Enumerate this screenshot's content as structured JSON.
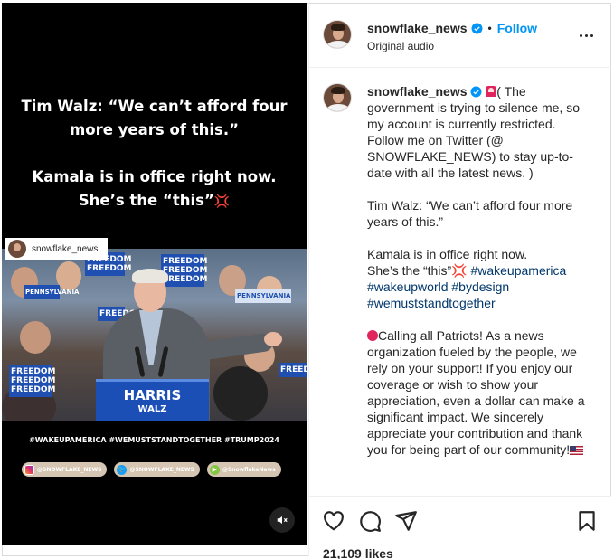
{
  "media": {
    "overlay_line1": "Tim Walz: “We can’t afford four",
    "overlay_line2": "more years of this.”",
    "overlay_line3": "Kamala is in office right now.",
    "overlay_line4": "She’s the “this”",
    "repost_tag": "snowflake_news",
    "sign_text": "FREEDOM",
    "state_sign": "PENNSYLVANIA",
    "podium_title": "HARRIS",
    "podium_subtitle": "WALZ",
    "hashtags": "#WAKEUPAMERICA #WEMUSTSTANDTOGETHER #TRUMP2024",
    "socials": [
      {
        "icon": "instagram-icon",
        "label": "@SNOWFLAKE_NEWS"
      },
      {
        "icon": "twitter-icon",
        "label": "@SNOWFLAKE_NEWS"
      },
      {
        "icon": "rumble-icon",
        "label": "@SnowflakeNews"
      }
    ]
  },
  "header": {
    "username": "snowflake_news",
    "separator": "•",
    "follow_label": "Follow",
    "audio": "Original audio"
  },
  "caption": {
    "username": "snowflake_news",
    "p1_a": "( The government is trying to silence me, so my account is currently restricted. Follow me on Twitter (@ SNOWFLAKE_NEWS) to stay up-to-date with all the latest news. )",
    "p2": "Tim Walz: “We can’t afford four more years of this.”",
    "p3_a": "Kamala is in office right now.",
    "p3_b": "She’s the “this”",
    "tag1": "#wakeupamerica",
    "tag2": "#wakeupworld",
    "tag3": "#bydesign",
    "tag4": "#wemuststandtogether",
    "p4": "Calling all Patriots! As a news organization fueled by the people, we rely on your support! If you enjoy our coverage or wish to show your appreciation, even a dollar can make a significant impact. We sincerely appreciate your contribution and thank you for being part of our community!"
  },
  "footer": {
    "likes": "21,109 likes"
  },
  "colors": {
    "accent": "#0095f6",
    "hashtag": "#00376b",
    "alert": "#e0245e"
  }
}
